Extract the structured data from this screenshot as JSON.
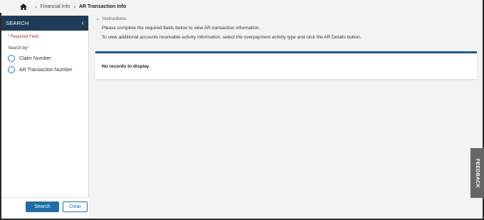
{
  "breadcrumb": {
    "items": [
      "Financial Info",
      "AR Transaction Info"
    ]
  },
  "sidebar": {
    "title": "SEARCH",
    "collapse_icon": "chevron-left-icon",
    "required_note": "* Required Field",
    "search_by_label": "Search by",
    "search_by_required_mark": "*",
    "options": [
      "Claim Number",
      "AR Transaction Number"
    ],
    "search_button": "Search",
    "clear_button": "Clear"
  },
  "instructions": {
    "toggle_label": "Instructions",
    "lines": [
      "Please complete the required fields below to view AR transaction information.",
      "To view additional accounts receivable activity information, select the overpayment activity type and click the AR Details button."
    ]
  },
  "results": {
    "empty_message": "No records to display"
  },
  "feedback": {
    "label": "FEEDBACK"
  },
  "colors": {
    "header_bg": "#1f3b57",
    "primary": "#1f6ea8",
    "required": "#d0262b",
    "card_accent": "#1f5c8c"
  }
}
